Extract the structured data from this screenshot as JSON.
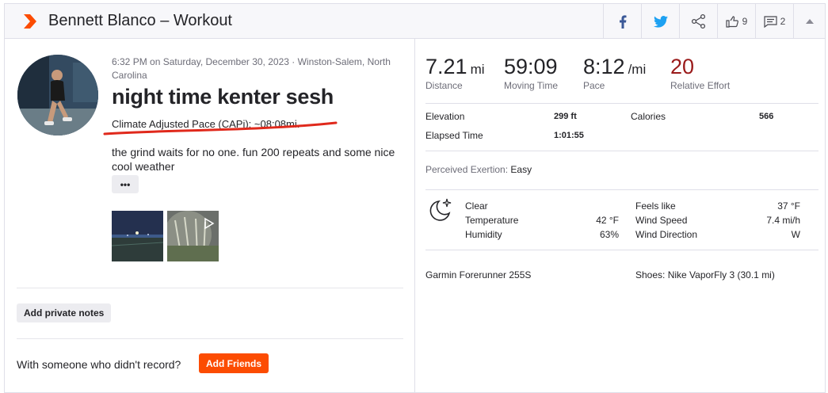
{
  "header": {
    "title": "Bennett Blanco – Workout",
    "kudos_count": "9",
    "comment_count": "2"
  },
  "activity": {
    "meta": "6:32 PM on Saturday, December 30, 2023 · Winston-Salem, North Carolina",
    "title": "night time kenter sesh",
    "capi": "Climate Adjusted Pace (CAPi): ~08:08mi.",
    "description": "the grind waits for no one. fun 200 repeats and some nice cool weather",
    "more_label": "•••",
    "private_notes_label": "Add private notes",
    "record_question": "With someone who didn't record?",
    "add_friends_label": "Add Friends"
  },
  "stats": [
    {
      "value": "7.21",
      "unit": "mi",
      "label": "Distance"
    },
    {
      "value": "59:09",
      "unit": "",
      "label": "Moving Time"
    },
    {
      "value": "8:12",
      "unit": "/mi",
      "label": "Pace"
    },
    {
      "value": "20",
      "unit": "",
      "label": "Relative Effort"
    }
  ],
  "details": {
    "elevation_label": "Elevation",
    "elevation_value": "299 ft",
    "elapsed_label": "Elapsed Time",
    "elapsed_value": "1:01:55",
    "calories_label": "Calories",
    "calories_value": "566"
  },
  "perceived": {
    "label": "Perceived Exertion:",
    "value": "Easy"
  },
  "weather": {
    "condition": "Clear",
    "temperature_label": "Temperature",
    "temperature_value": "42 °F",
    "humidity_label": "Humidity",
    "humidity_value": "63%",
    "feels_like_label": "Feels like",
    "feels_like_value": "37 °F",
    "wind_speed_label": "Wind Speed",
    "wind_speed_value": "7.4 mi/h",
    "wind_direction_label": "Wind Direction",
    "wind_direction_value": "W"
  },
  "gear": {
    "device": "Garmin Forerunner 255S",
    "shoes": "Shoes: Nike VaporFly 3 (30.1 mi)"
  },
  "colors": {
    "brand": "#fc4c02",
    "effort": "#9a1a1a",
    "facebook": "#3b5998",
    "twitter": "#1da1f2",
    "annotation": "#e0291c"
  },
  "icons": [
    "strava-logo-icon",
    "facebook-icon",
    "twitter-icon",
    "share-icon",
    "kudos-thumb-icon",
    "comment-icon",
    "collapse-caret-icon",
    "moon-stars-icon"
  ]
}
